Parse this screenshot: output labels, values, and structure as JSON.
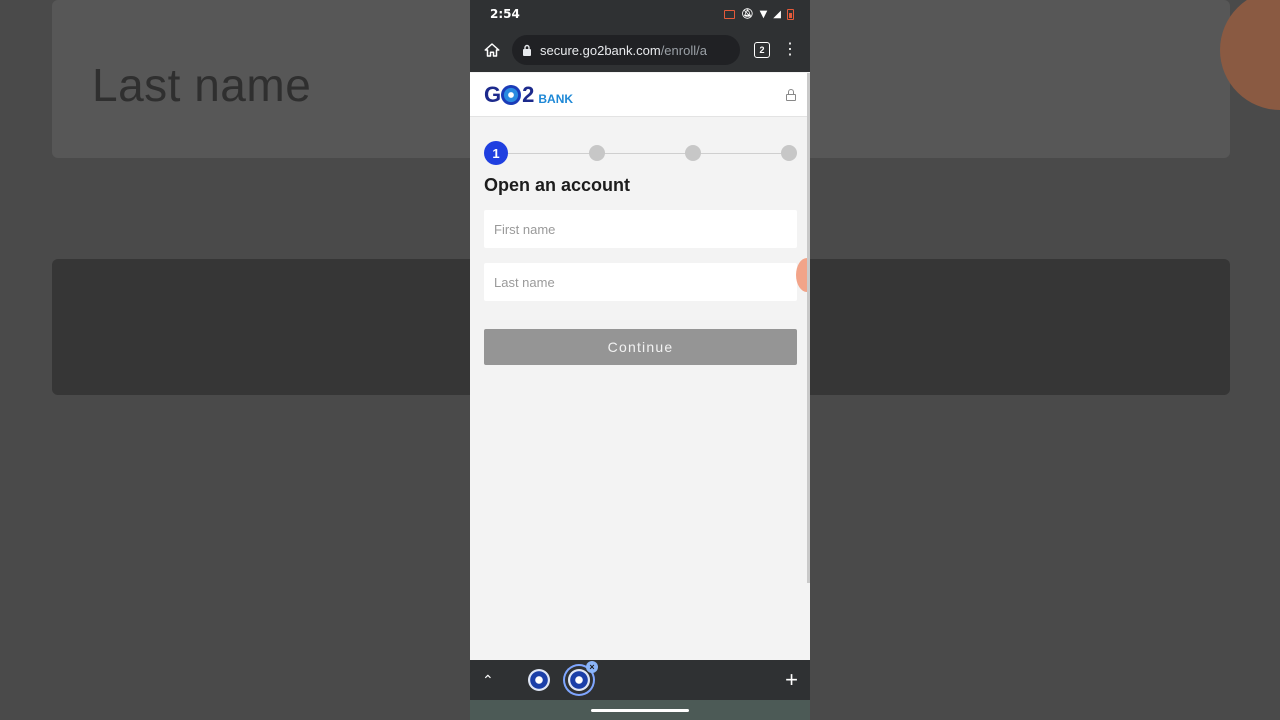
{
  "background": {
    "zoomed_label": "Last name"
  },
  "status_bar": {
    "time": "2:54"
  },
  "browser": {
    "url_domain": "secure.go2bank.com",
    "url_path": "/enroll/a",
    "tab_count": "2"
  },
  "site": {
    "logo_go": "G",
    "logo_two": "2",
    "logo_bank": "BANK"
  },
  "stepper": {
    "current_step": "1",
    "total_steps": 4
  },
  "form": {
    "title": "Open an account",
    "first_name_placeholder": "First name",
    "last_name_placeholder": "Last name",
    "continue_label": "Continue"
  },
  "colors": {
    "brand_blue": "#1f3fe0",
    "button_disabled": "#959595"
  }
}
